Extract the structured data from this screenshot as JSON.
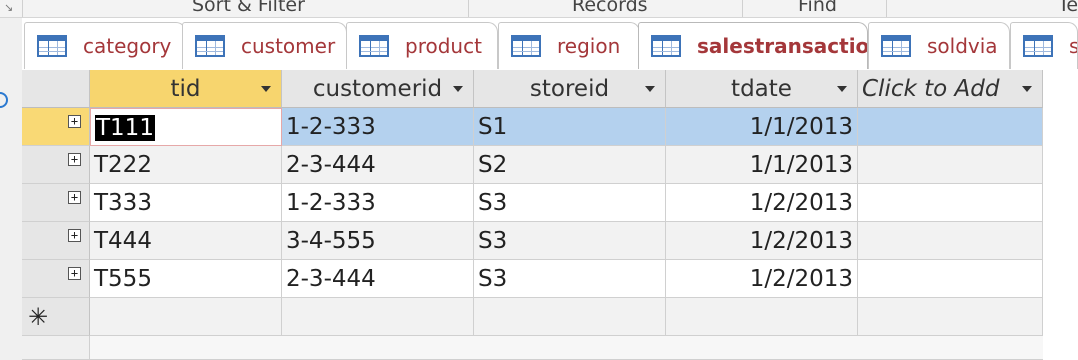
{
  "ribbon": {
    "groups": [
      "Sort & Filter",
      "Records",
      "Find",
      "Te"
    ]
  },
  "tabs": [
    {
      "label": "category",
      "icon": "table-icon"
    },
    {
      "label": "customer",
      "icon": "table-icon"
    },
    {
      "label": "product",
      "icon": "table-icon"
    },
    {
      "label": "region",
      "icon": "table-icon"
    },
    {
      "label": "salestransaction",
      "icon": "table-icon",
      "active": true
    },
    {
      "label": "soldvia",
      "icon": "table-icon"
    },
    {
      "label": "s",
      "icon": "table-icon"
    }
  ],
  "datasheet": {
    "columns": [
      "tid",
      "customerid",
      "storeid",
      "tdate",
      "Click to Add"
    ],
    "rows": [
      {
        "tid": "T111",
        "customerid": "1-2-333",
        "storeid": "S1",
        "tdate": "1/1/2013"
      },
      {
        "tid": "T222",
        "customerid": "2-3-444",
        "storeid": "S2",
        "tdate": "1/1/2013"
      },
      {
        "tid": "T333",
        "customerid": "1-2-333",
        "storeid": "S3",
        "tdate": "1/2/2013"
      },
      {
        "tid": "T444",
        "customerid": "3-4-555",
        "storeid": "S3",
        "tdate": "1/2/2013"
      },
      {
        "tid": "T555",
        "customerid": "2-3-444",
        "storeid": "S3",
        "tdate": "1/2/2013"
      }
    ],
    "new_record_marker": "✳",
    "expander_glyph": "+"
  },
  "colors": {
    "tab_text": "#a4373a",
    "header_selected": "#f7d56e",
    "row_selected": "#b4d1ee"
  }
}
